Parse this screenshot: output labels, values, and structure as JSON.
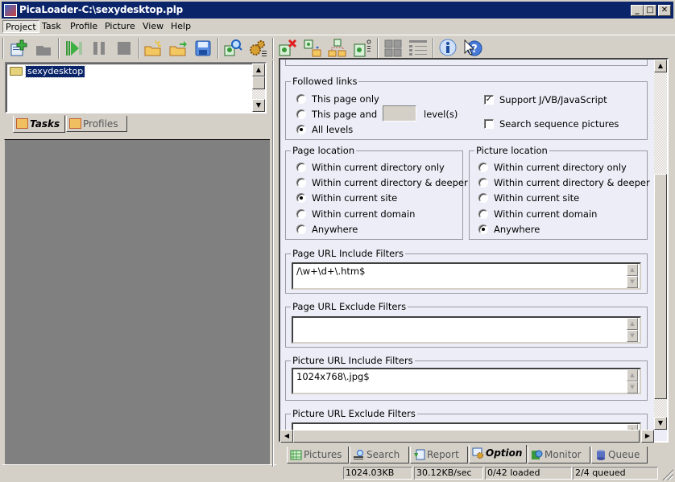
{
  "window": {
    "title": "PicaLoader-C:\\sexydesktop.plp",
    "minimize": "_",
    "maximize": "□",
    "close": "✕"
  },
  "menu": [
    {
      "label": "Project",
      "active": true
    },
    {
      "label": "Task"
    },
    {
      "label": "Profile"
    },
    {
      "label": "Picture"
    },
    {
      "label": "View"
    },
    {
      "label": "Help"
    }
  ],
  "toolbar": {
    "buttons": [
      "new-task",
      "open-disabled",
      "start",
      "pause",
      "stop",
      "new-project",
      "open-project",
      "save-project",
      "find-pictures",
      "settings",
      "delete-picture",
      "move-picture",
      "copy-picture",
      "picture-properties",
      "thumbnail-view",
      "details-view",
      "about",
      "help"
    ]
  },
  "tree": {
    "items": [
      {
        "label": "sexydesktop",
        "selected": true,
        "icon": "folder-icon"
      }
    ]
  },
  "left_tabs": [
    {
      "label": "Tasks",
      "active": true
    },
    {
      "label": "Profiles",
      "active": false
    }
  ],
  "options": {
    "followed_links": {
      "legend": "Followed links",
      "radios": [
        {
          "label": "This page only",
          "checked": false
        },
        {
          "label": "This page and",
          "checked": false
        },
        {
          "label": "All levels",
          "checked": true
        }
      ],
      "levels_value": "",
      "levels_suffix": "level(s)",
      "checkboxes": [
        {
          "label": "Support J/VB/JavaScript",
          "checked": true
        },
        {
          "label": "Search sequence pictures",
          "checked": false
        }
      ]
    },
    "page_location": {
      "legend": "Page location",
      "radios": [
        {
          "label": "Within current directory only",
          "checked": false
        },
        {
          "label": "Within current directory & deeper",
          "checked": false
        },
        {
          "label": "Within current site",
          "checked": true
        },
        {
          "label": "Within current domain",
          "checked": false
        },
        {
          "label": "Anywhere",
          "checked": false
        }
      ]
    },
    "picture_location": {
      "legend": "Picture location",
      "radios": [
        {
          "label": "Within current directory only",
          "checked": false
        },
        {
          "label": "Within current directory & deeper",
          "checked": false
        },
        {
          "label": "Within current site",
          "checked": false
        },
        {
          "label": "Within current domain",
          "checked": false
        },
        {
          "label": "Anywhere",
          "checked": true
        }
      ]
    },
    "page_url_include": {
      "legend": "Page URL Include Filters",
      "value": "/\\w+\\d+\\.htm$"
    },
    "page_url_exclude": {
      "legend": "Page URL Exclude Filters",
      "value": ""
    },
    "picture_url_include": {
      "legend": "Picture URL Include Filters",
      "value": "1024x768\\.jpg$"
    },
    "picture_url_exclude": {
      "legend": "Picture URL Exclude Filters",
      "value": ""
    }
  },
  "bottom_tabs": [
    {
      "label": "Pictures",
      "active": false
    },
    {
      "label": "Search",
      "active": false
    },
    {
      "label": "Report",
      "active": false
    },
    {
      "label": "Option",
      "active": true
    },
    {
      "label": "Monitor",
      "active": false
    },
    {
      "label": "Queue",
      "active": false
    }
  ],
  "status": {
    "size": "1024.03KB",
    "speed": "30.12KB/sec",
    "loaded": "0/42 loaded",
    "queued": "2/4 queued"
  }
}
